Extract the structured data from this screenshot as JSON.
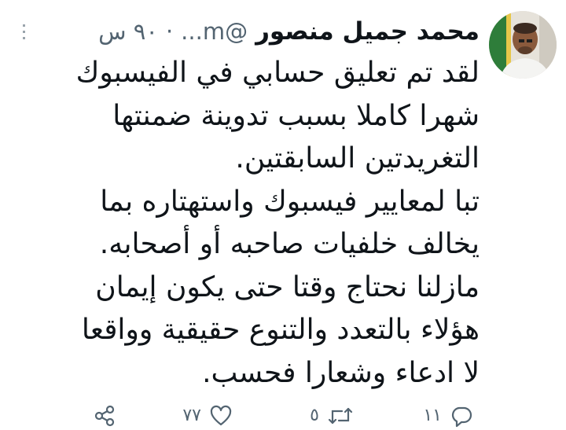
{
  "tweet": {
    "author_name": "محمد جميل منصور",
    "handle": "@m...",
    "separator": "·",
    "time": "٩٠ س",
    "lines": [
      "لقد تم تعليق حسابي في الفيسبوك",
      "شهرا كاملا بسبب تدوينة ضمنتها",
      "التغريدتين السابقتين.",
      "تبا لمعايير فيسبوك واستهتاره بما",
      "يخالف خلفيات صاحبه أو أصحابه.",
      "مازلنا نحتاج وقتا حتى يكون إيمان",
      "هؤلاء بالتعدد والتنوع حقيقية وواقعا",
      "لا ادعاء وشعارا فحسب."
    ],
    "actions": {
      "replies": "١١",
      "retweets": "٥",
      "likes": "٧٧"
    }
  },
  "icons": {
    "more": "more-dots-icon",
    "reply": "reply-icon",
    "retweet": "retweet-icon",
    "like": "heart-icon",
    "share": "share-icon"
  },
  "colors": {
    "text": "#0f1419",
    "secondary": "#536471",
    "background": "#ffffff"
  }
}
